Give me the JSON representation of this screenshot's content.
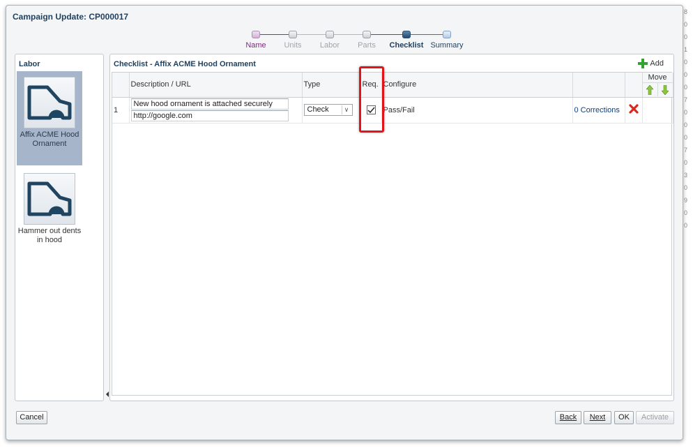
{
  "dialog": {
    "title": "Campaign Update: CP000017"
  },
  "train": {
    "stops": [
      {
        "label": "Name",
        "state": "visited"
      },
      {
        "label": "Units",
        "state": "unvisited"
      },
      {
        "label": "Labor",
        "state": "unvisited"
      },
      {
        "label": "Parts",
        "state": "unvisited"
      },
      {
        "label": "Checklist",
        "state": "current"
      },
      {
        "label": "Summary",
        "state": "next"
      }
    ]
  },
  "labor_panel": {
    "title": "Labor",
    "items": [
      {
        "label": "Affix ACME Hood Ornament",
        "selected": true
      },
      {
        "label": "Hammer out dents in hood",
        "selected": false
      }
    ]
  },
  "checklist_panel": {
    "title": "Checklist - Affix ACME Hood Ornament",
    "add_label": "Add",
    "columns": {
      "description": "Description / URL",
      "type": "Type",
      "required": "Req.",
      "configure": "Configure",
      "move": "Move"
    },
    "rows": [
      {
        "index": "1",
        "description": "New hood ornament is attached securely",
        "url": "http://google.com",
        "type": "Check",
        "required": true,
        "configure": "Pass/Fail",
        "corrections": "0 Corrections"
      }
    ]
  },
  "footer": {
    "cancel": "Cancel",
    "back": "Back",
    "next": "Next",
    "ok": "OK",
    "activate": "Activate"
  },
  "right_edge_glyphs": [
    "8",
    "0",
    "0",
    "1",
    "0",
    "0",
    "0",
    "7",
    "0",
    "0",
    "0",
    "7",
    "0",
    "3",
    "0",
    "9",
    "0",
    "0"
  ],
  "colors": {
    "title": "#1e3f5e",
    "visited": "#7c2a7e",
    "highlight": "#e0151b",
    "add_icon": "#2fa52f",
    "delete_icon": "#d9281c",
    "move_arrow": "#8cc63f"
  }
}
